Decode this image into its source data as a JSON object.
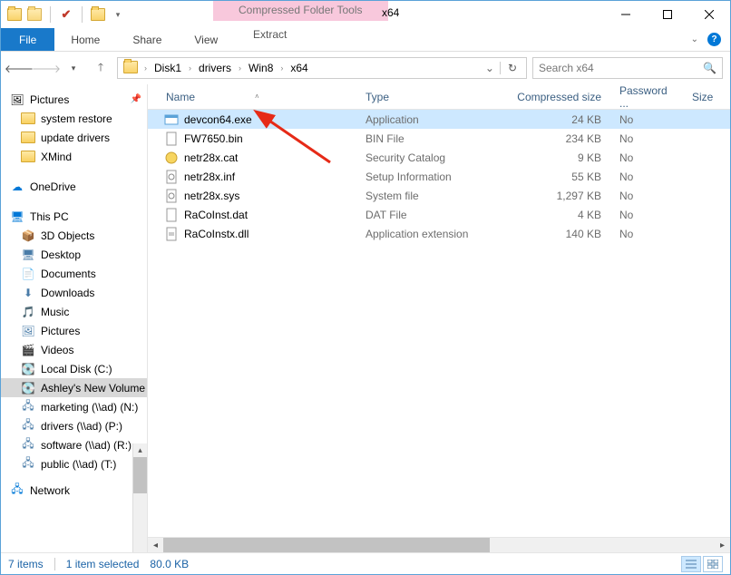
{
  "title": "x64",
  "context_tab": "Compressed Folder Tools",
  "ribbon": {
    "file": "File",
    "tabs": [
      "Home",
      "Share",
      "View"
    ],
    "context": "Extract"
  },
  "breadcrumbs": [
    "Disk1",
    "drivers",
    "Win8",
    "x64"
  ],
  "search_placeholder": "Search x64",
  "nav": {
    "quick": {
      "label": "Pictures",
      "pinned": true
    },
    "quick_items": [
      "system restore",
      "update drivers",
      "XMind"
    ],
    "onedrive": "OneDrive",
    "thispc": "This PC",
    "pc_items": [
      {
        "label": "3D Objects",
        "icon": "cube"
      },
      {
        "label": "Desktop",
        "icon": "desktop"
      },
      {
        "label": "Documents",
        "icon": "doc"
      },
      {
        "label": "Downloads",
        "icon": "down"
      },
      {
        "label": "Music",
        "icon": "music"
      },
      {
        "label": "Pictures",
        "icon": "pic"
      },
      {
        "label": "Videos",
        "icon": "vid"
      },
      {
        "label": "Local Disk (C:)",
        "icon": "disk"
      },
      {
        "label": "Ashley's New Volume",
        "icon": "disk",
        "selected": true
      },
      {
        "label": "marketing (\\\\ad) (N:)",
        "icon": "net"
      },
      {
        "label": "drivers (\\\\ad) (P:)",
        "icon": "net"
      },
      {
        "label": "software (\\\\ad) (R:)",
        "icon": "net"
      },
      {
        "label": "public (\\\\ad) (T:)",
        "icon": "net"
      }
    ],
    "network": "Network"
  },
  "columns": {
    "name": "Name",
    "type": "Type",
    "size": "Compressed size",
    "pwd": "Password ...",
    "sz2": "Size"
  },
  "files": [
    {
      "name": "devcon64.exe",
      "type": "Application",
      "size": "24 KB",
      "pwd": "No",
      "icon": "exe",
      "selected": true
    },
    {
      "name": "FW7650.bin",
      "type": "BIN File",
      "size": "234 KB",
      "pwd": "No",
      "icon": "blank"
    },
    {
      "name": "netr28x.cat",
      "type": "Security Catalog",
      "size": "9 KB",
      "pwd": "No",
      "icon": "cat"
    },
    {
      "name": "netr28x.inf",
      "type": "Setup Information",
      "size": "55 KB",
      "pwd": "No",
      "icon": "inf"
    },
    {
      "name": "netr28x.sys",
      "type": "System file",
      "size": "1,297 KB",
      "pwd": "No",
      "icon": "sys"
    },
    {
      "name": "RaCoInst.dat",
      "type": "DAT File",
      "size": "4 KB",
      "pwd": "No",
      "icon": "blank"
    },
    {
      "name": "RaCoInstx.dll",
      "type": "Application extension",
      "size": "140 KB",
      "pwd": "No",
      "icon": "dll"
    }
  ],
  "status": {
    "count": "7 items",
    "selected": "1 item selected",
    "size": "80.0 KB"
  }
}
